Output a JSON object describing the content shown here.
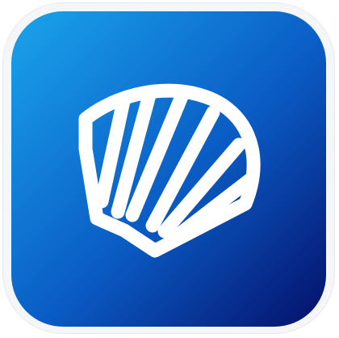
{
  "app_icon": {
    "icon_name": "scallop-shell-icon",
    "colors": {
      "gradient_start": "#1aa4ec",
      "gradient_mid": "#0a5bc4",
      "gradient_end": "#050f6a",
      "shell": "#ffffff",
      "tile_border": "#f4f6f8"
    }
  }
}
